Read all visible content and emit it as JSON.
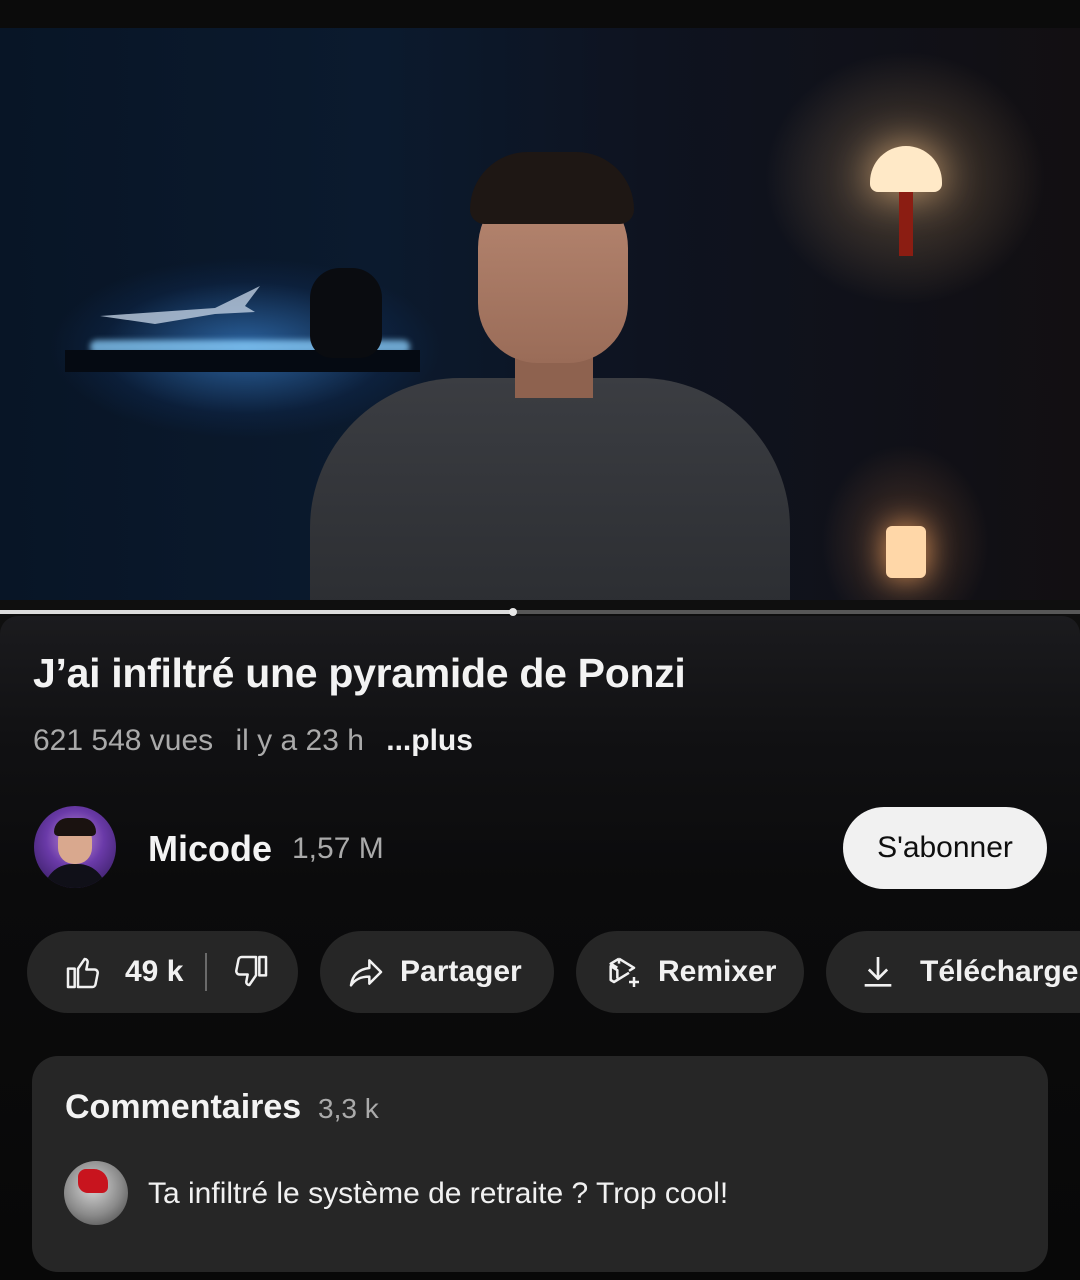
{
  "video": {
    "title": "J’ai infiltré une pyramide de Ponzi",
    "views": "621 548 vues",
    "age": "il y a 23 h",
    "more_label": "...plus",
    "progress": 0.475
  },
  "channel": {
    "name": "Micode",
    "subscribers": "1,57 M",
    "subscribe_label": "S'abonner"
  },
  "actions": {
    "like_count": "49 k",
    "share_label": "Partager",
    "remix_label": "Remixer",
    "download_label": "Télécharger"
  },
  "comments": {
    "title": "Commentaires",
    "count": "3,3 k",
    "top_comment": "Ta infiltré le système de retraite ? Trop cool!"
  },
  "icons": [
    "thumbs-up-icon",
    "thumbs-down-icon",
    "share-arrow-icon",
    "remix-icon",
    "download-icon"
  ],
  "colors": {
    "background": "#0f0f0f",
    "pill": "#262626",
    "subscribe_bg": "#f1f1f1",
    "secondary_text": "#aaaaaa"
  }
}
